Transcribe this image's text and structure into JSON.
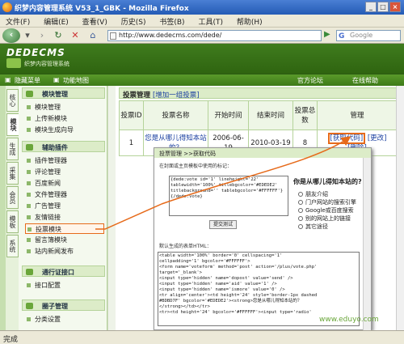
{
  "window": {
    "title": "织梦内容管理系统 V53_1_GBK - Mozilla Firefox"
  },
  "menu": [
    "文件(F)",
    "编辑(E)",
    "查看(V)",
    "历史(S)",
    "书签(B)",
    "工具(T)",
    "帮助(H)"
  ],
  "nav": {
    "url": "http://www.dedecms.com/dede/",
    "search_placeholder": "Google"
  },
  "header": {
    "logo": "DEDECMS",
    "subtitle": "织梦内容管理系统"
  },
  "subbar": {
    "hide_menu": "隐藏菜单",
    "feature_map": "功能地图",
    "forum": "官方论坛",
    "help": "在线帮助"
  },
  "vtabs": [
    "核心",
    "模块",
    "生成",
    "采集",
    "会员",
    "模板",
    "系统"
  ],
  "sidebar": {
    "groups": [
      "模块管理",
      "辅助插件",
      "通行证接口",
      "圈子管理"
    ],
    "module_items": [
      "模块管理",
      "上传新模块",
      "模块生成向导"
    ],
    "plugin_items": [
      "插件管理器",
      "评论管理",
      "百度新闻",
      "文件管理器",
      "广告管理",
      "友情链接",
      "投票模块",
      "留言簿模块",
      "站内新闻发布"
    ],
    "passport_items": [
      "接口配置"
    ],
    "circle_items": [
      "分类设置"
    ]
  },
  "main": {
    "header_title": "投票管理",
    "header_link": "[增加一组投票]",
    "columns": [
      "投票ID",
      "投票名称",
      "开始时间",
      "结束时间",
      "投票总数",
      "管理"
    ],
    "row": {
      "id": "1",
      "name": "您是从哪儿得知本站的？",
      "start": "2006-06-19",
      "end": "2010-03-19",
      "total": "8",
      "getcode": "[获取代码]",
      "edit": "[更改]",
      "delete": "[删除]"
    }
  },
  "popup": {
    "title": "投票管理 >>获取代码",
    "label1": "在封面或主页模板中使用的标记：",
    "tag_code": "{dede:vote id='1' lineheight='22'\ntablewidth='100%' titlebgcolor='#EDEDE2'\ntitlebackground='' tablebgcolor='#FFFFFF'}\n{/dede:vote}",
    "button": "提交测试",
    "label2": "默认生成的表单HTML：",
    "html_code": "<table width='100%' border='0' cellspacing='1'\ncellpadding='1' bgcolor='#FFFFFF'>\n<form name='voteform' method='post' action='/plus/vote.php'\ntarget='_blank'>\n<input type='hidden' name='dopost' value='send' />\n<input type='hidden' name='aid' value='1' />\n<input type='hidden' name='ismore' value='0' />\n<tr align='center'><td height='24' style='border-1px dashed\n#BDBD7F' bgcolor='#EDEDE2'><strong>您是从哪儿得知本站的？\n</strong></td></tr>\n<tr><td height='24' bgcolor='#FFFFFF'><input type='radio'",
    "question": "你是从哪儿得知本站的?",
    "options": [
      "朋友介绍",
      "门户网站的搜索引擎",
      "Google或百度搜索",
      "别的网站上的链接",
      "其它途径"
    ]
  },
  "watermark": "www.eduyo.com",
  "status": "完成"
}
